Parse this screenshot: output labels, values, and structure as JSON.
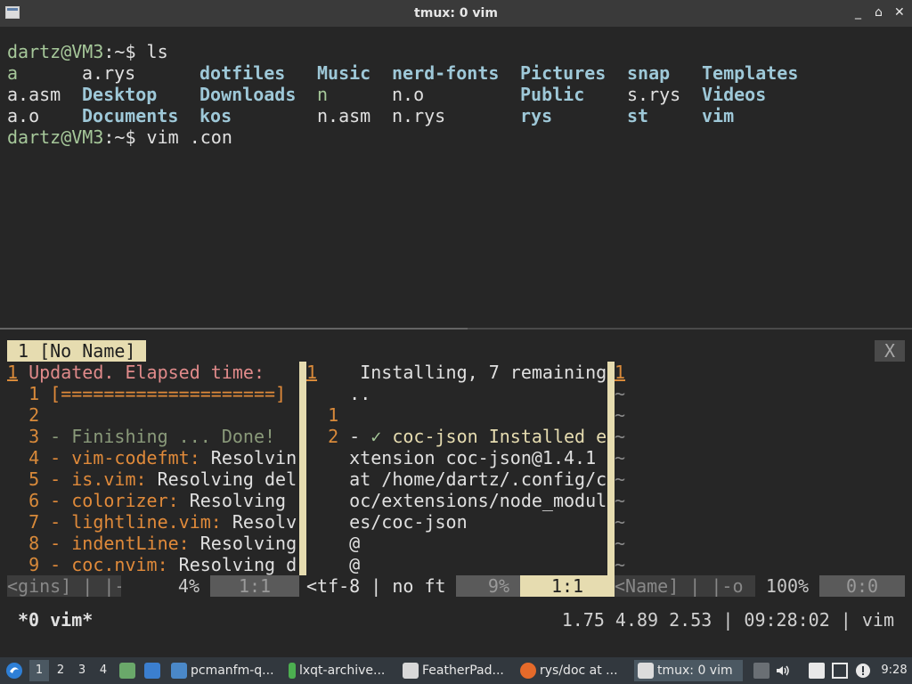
{
  "window": {
    "title": "tmux: 0 vim",
    "controls": [
      "_",
      "⌂",
      "✕"
    ]
  },
  "shell": {
    "prompt1": {
      "user": "dartz@VM3",
      "path": ":~$",
      "command": " ls"
    },
    "listing": [
      [
        {
          "t": "a",
          "c": "green"
        },
        {
          "t": "a.rys",
          "c": "plain"
        },
        {
          "t": "dotfiles",
          "c": "blue-bold"
        },
        {
          "t": "Music",
          "c": "blue-bold"
        },
        {
          "t": "nerd-fonts",
          "c": "blue-bold"
        },
        {
          "t": "Pictures",
          "c": "blue-bold"
        },
        {
          "t": "snap",
          "c": "blue-bold"
        },
        {
          "t": "Templates",
          "c": "blue-bold"
        }
      ],
      [
        {
          "t": "a.asm",
          "c": "plain"
        },
        {
          "t": "Desktop",
          "c": "blue-bold"
        },
        {
          "t": "Downloads",
          "c": "blue-bold"
        },
        {
          "t": "n",
          "c": "green"
        },
        {
          "t": "n.o",
          "c": "plain"
        },
        {
          "t": "Public",
          "c": "blue-bold"
        },
        {
          "t": "s.rys",
          "c": "plain"
        },
        {
          "t": "Videos",
          "c": "blue-bold"
        }
      ],
      [
        {
          "t": "a.o",
          "c": "plain"
        },
        {
          "t": "Documents",
          "c": "blue-bold"
        },
        {
          "t": "kos",
          "c": "blue-bold"
        },
        {
          "t": "n.asm",
          "c": "plain"
        },
        {
          "t": "n.rys",
          "c": "plain"
        },
        {
          "t": "rys",
          "c": "blue-bold"
        },
        {
          "t": "st",
          "c": "blue-bold"
        },
        {
          "t": "vim",
          "c": "blue-bold"
        }
      ]
    ],
    "prompt2": {
      "user": "dartz@VM3",
      "path": ":~$",
      "command": " vim .con"
    }
  },
  "vim": {
    "tab_label": "1 [No Name]",
    "tab_close": "X",
    "left_pane": [
      {
        "n": "1",
        "t": " Updated. Elapsed time: ",
        "c": "pink",
        "num_underline": true
      },
      {
        "n": "  1",
        "t": " [====================]",
        "c": "orange"
      },
      {
        "n": "  2",
        "t": "",
        "c": "plain"
      },
      {
        "n": "  3",
        "t": " - Finishing ... Done!",
        "c": "muted"
      },
      {
        "n": "  4",
        "t": " - vim-codefmt: ",
        "c": "orange",
        "rest": "Resolvin"
      },
      {
        "n": "  5",
        "t": " - is.vim: ",
        "c": "orange",
        "rest": "Resolving del"
      },
      {
        "n": "  6",
        "t": " - colorizer: ",
        "c": "orange",
        "rest": "Resolving"
      },
      {
        "n": "  7",
        "t": " - lightline.vim: ",
        "c": "orange",
        "rest": "Resolv"
      },
      {
        "n": "  8",
        "t": " - indentLine: ",
        "c": "orange",
        "rest": "Resolving"
      },
      {
        "n": "  9",
        "t": " - coc.nvim: ",
        "c": "orange",
        "rest": "Resolving d"
      }
    ],
    "mid_pane": [
      {
        "n": "1",
        "t": "    Installing, 7 remaining.",
        "num_underline": true
      },
      {
        "n": "",
        "t": "    .."
      },
      {
        "n": "  1",
        "t": ""
      },
      {
        "n": "  2",
        "t": " - ✓ coc-json Installed e"
      },
      {
        "n": "",
        "t": "    xtension coc-json@1.4.1"
      },
      {
        "n": "",
        "t": "    at /home/dartz/.config/c"
      },
      {
        "n": "",
        "t": "    oc/extensions/node_modul"
      },
      {
        "n": "",
        "t": "    es/coc-json"
      },
      {
        "n": "",
        "t": "    @"
      },
      {
        "n": "",
        "t": "    @"
      }
    ],
    "right_pane": {
      "first_num": "1",
      "tildes": 9,
      "tilde": "~"
    },
    "status": {
      "left": {
        "a": "<gins] | |-o",
        "pct": "4%",
        "pos": "1:1"
      },
      "mid": {
        "a": "<tf-8 | no ft",
        "pct": "9%",
        "pos": "1:1"
      },
      "right": {
        "a": "<Name] | |-o",
        "pct": "100%",
        "pos": "0:0"
      }
    }
  },
  "tmux": {
    "window": "*0 vim*",
    "load": "1.75 4.89 2.53",
    "time": "09:28:02",
    "session": "vim"
  },
  "taskbar": {
    "desktops": [
      "1",
      "2",
      "3",
      "4"
    ],
    "active_desktop": "1",
    "tasks": [
      "pcmanfm-q...",
      "lxqt-archive...",
      "FeatherPad...",
      "rys/doc at ...",
      "tmux: 0 vim"
    ],
    "clock": "9:28"
  }
}
